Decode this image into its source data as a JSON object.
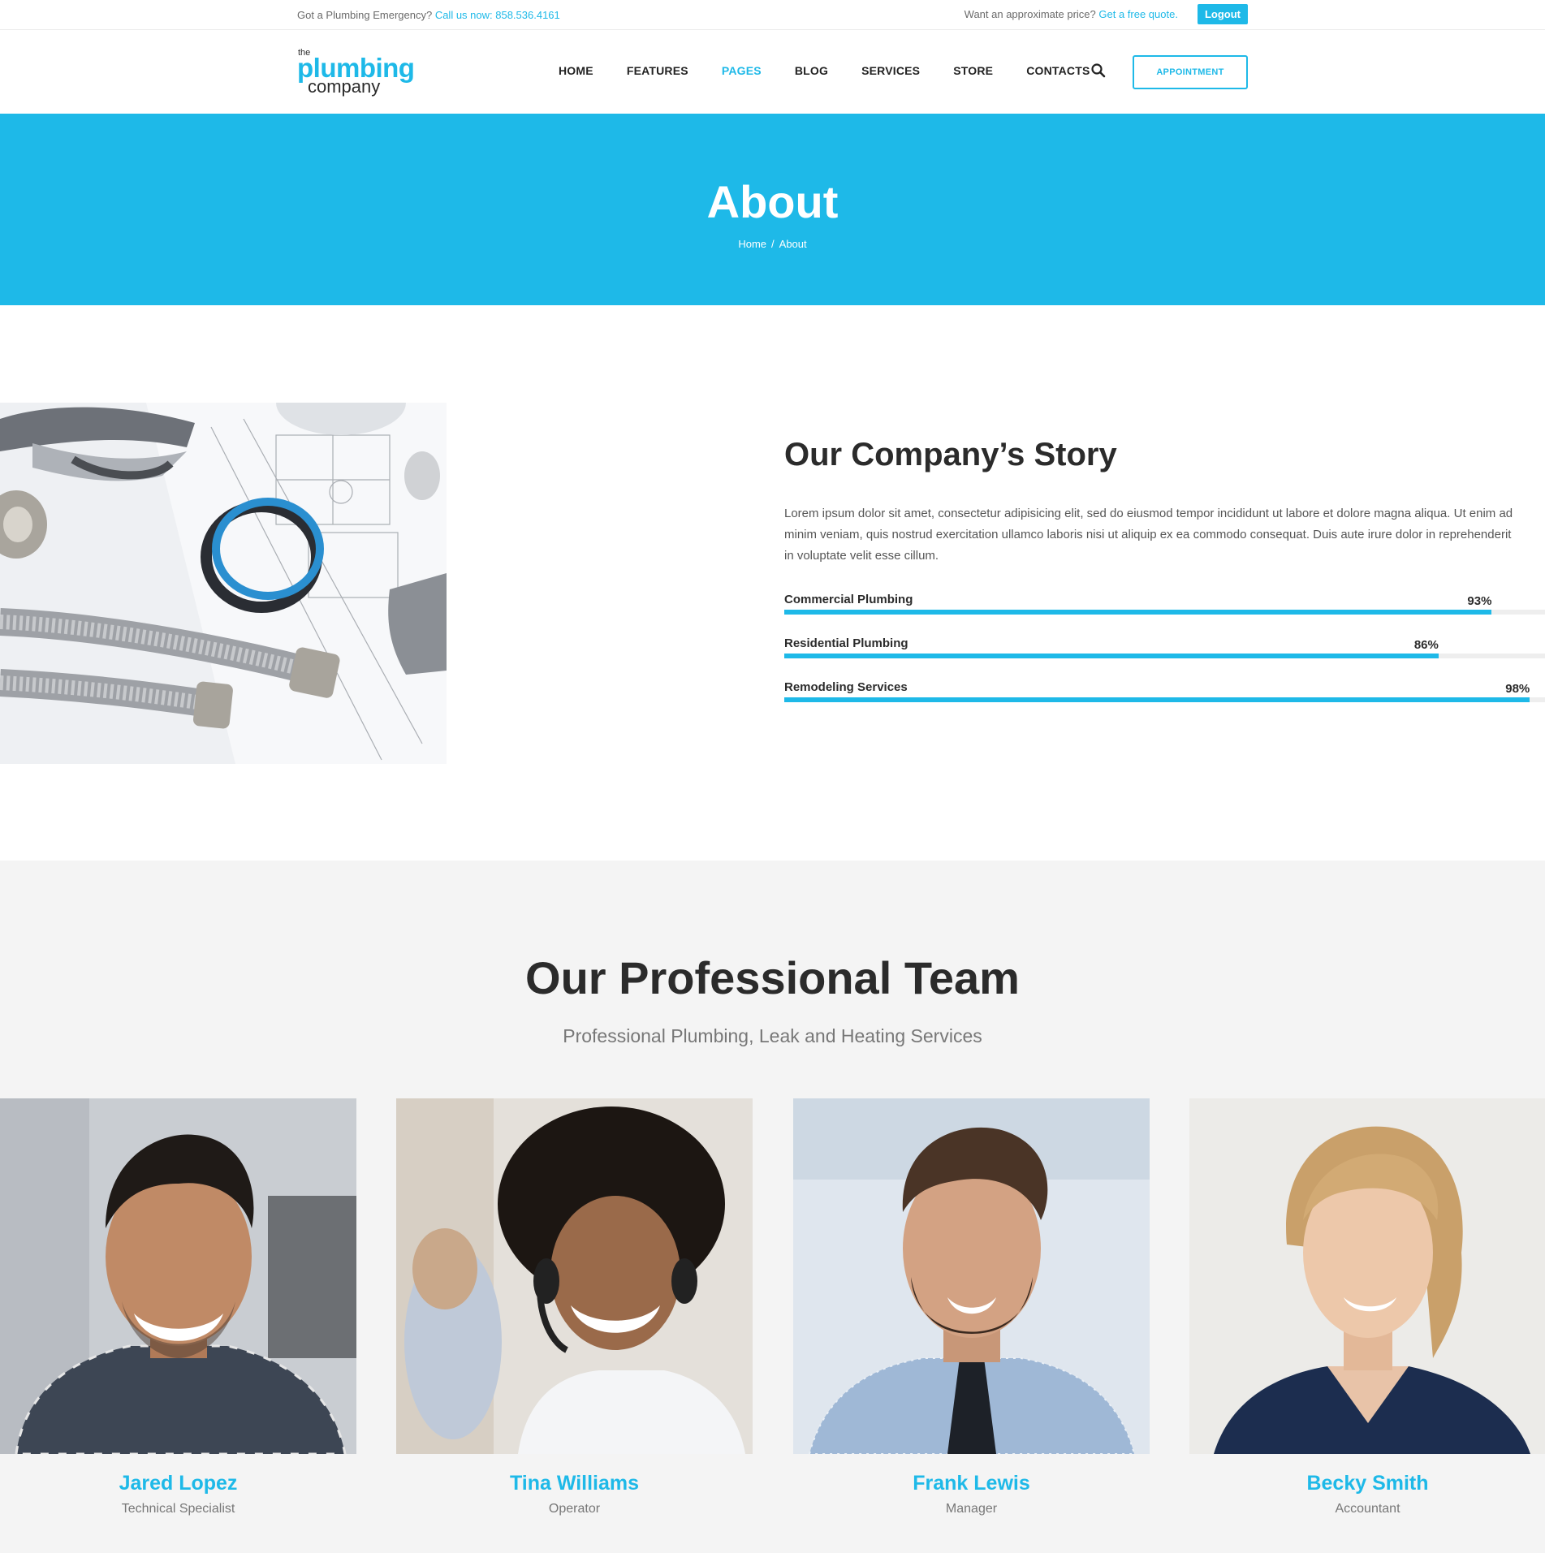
{
  "topbar": {
    "emergency_text": "Got a Plumbing Emergency? ",
    "call_link": "Call us now: 858.536.4161",
    "price_text": "Want an approximate price? ",
    "quote_link": "Get a free quote.",
    "logout_label": "Logout"
  },
  "header": {
    "logo_the": "the",
    "logo_plumbing": "plumbing",
    "logo_company": "company",
    "nav": [
      "HOME",
      "FEATURES",
      "PAGES",
      "BLOG",
      "SERVICES",
      "STORE",
      "CONTACTS"
    ],
    "active_nav": "PAGES",
    "search_icon": "search-icon",
    "appointment_label": "APPOINTMENT"
  },
  "hero": {
    "title": "About",
    "breadcrumb_home": "Home",
    "breadcrumb_sep": "/",
    "breadcrumb_current": "About"
  },
  "story": {
    "title": "Our Company’s Story",
    "text_line1": "Lorem ipsum dolor sit amet, consectetur adipisicing elit, sed do eiusmod tempor incididunt ut labore et dolore magna aliqua. Ut enim ad",
    "text_line2": "minim veniam, quis nostrud exercitation ullamco laboris nisi ut aliquip ex ea commodo consequat. Duis aute irure dolor in reprehenderit",
    "text_line3": "in voluptate velit esse cillum.",
    "skills": [
      {
        "label": "Commercial Plumbing",
        "percent": 93,
        "display": "93%"
      },
      {
        "label": "Residential Plumbing",
        "percent": 86,
        "display": "86%"
      },
      {
        "label": "Remodeling Services",
        "percent": 98,
        "display": "98%"
      }
    ]
  },
  "team": {
    "title": "Our Professional Team",
    "subtitle": "Professional Plumbing, Leak and Heating Services",
    "members": [
      {
        "name": "Jared Lopez",
        "role": "Technical Specialist"
      },
      {
        "name": "Tina Williams",
        "role": "Operator"
      },
      {
        "name": "Frank Lewis",
        "role": "Manager"
      },
      {
        "name": "Becky Smith",
        "role": "Accountant"
      }
    ]
  },
  "colors": {
    "accent": "#1eb9e8",
    "text_dark": "#2b2b2b",
    "team_bg": "#f4f4f4"
  }
}
